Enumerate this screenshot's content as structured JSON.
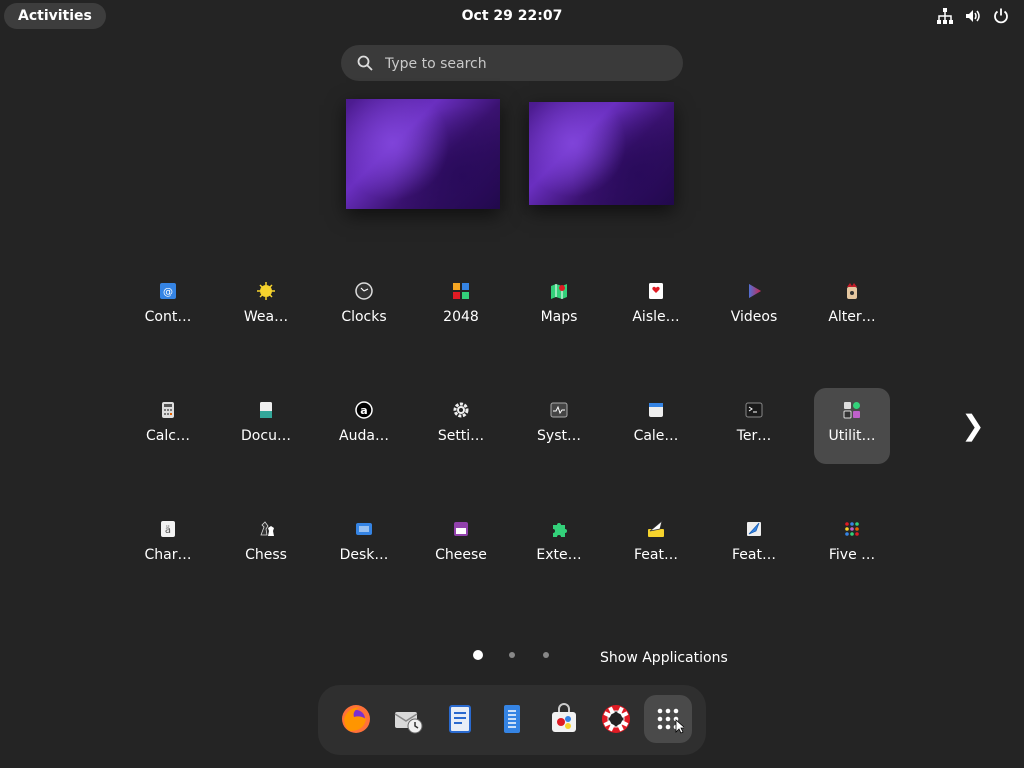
{
  "topbar": {
    "activities_label": "Activities",
    "clock_text": "Oct 29  22:07",
    "tray_icons": [
      "network-icon",
      "volume-icon",
      "power-icon"
    ]
  },
  "search": {
    "placeholder": "Type to search"
  },
  "workspaces": [
    "workspace-1",
    "workspace-2"
  ],
  "apps": [
    {
      "label": "Cont…",
      "icon": "contacts-icon"
    },
    {
      "label": "Wea…",
      "icon": "weather-icon"
    },
    {
      "label": "Clocks",
      "icon": "clocks-icon"
    },
    {
      "label": "2048",
      "icon": "2048-icon"
    },
    {
      "label": "Maps",
      "icon": "maps-icon"
    },
    {
      "label": "Aisle…",
      "icon": "aisleriot-icon"
    },
    {
      "label": "Videos",
      "icon": "videos-icon"
    },
    {
      "label": "Alter…",
      "icon": "alternative-icon"
    },
    {
      "label": "Calc…",
      "icon": "calculator-icon"
    },
    {
      "label": "Docu…",
      "icon": "document-scanner-icon"
    },
    {
      "label": "Auda…",
      "icon": "audacity-icon"
    },
    {
      "label": "Setti…",
      "icon": "settings-icon"
    },
    {
      "label": "Syst…",
      "icon": "system-monitor-icon"
    },
    {
      "label": "Cale…",
      "icon": "calendar-icon"
    },
    {
      "label": "Ter…",
      "icon": "terminal-icon"
    },
    {
      "label": "Utilit…",
      "icon": "utilities-folder-icon"
    },
    {
      "label": "Char…",
      "icon": "characters-icon"
    },
    {
      "label": "Chess",
      "icon": "chess-icon"
    },
    {
      "label": "Desk…",
      "icon": "desktop-icon"
    },
    {
      "label": "Cheese",
      "icon": "cheese-icon"
    },
    {
      "label": "Exte…",
      "icon": "extensions-icon"
    },
    {
      "label": "Feat…",
      "icon": "feather-icon"
    },
    {
      "label": "Feat…",
      "icon": "feather-pad-icon"
    },
    {
      "label": "Five …",
      "icon": "five-or-more-icon"
    }
  ],
  "pagination": {
    "pages": 3,
    "current": 1
  },
  "tooltip": {
    "show_applications": "Show Applications"
  },
  "dash": [
    "firefox-icon",
    "evolution-icon",
    "writer-icon",
    "text-editor-icon",
    "software-icon",
    "help-icon",
    "show-apps-icon"
  ]
}
